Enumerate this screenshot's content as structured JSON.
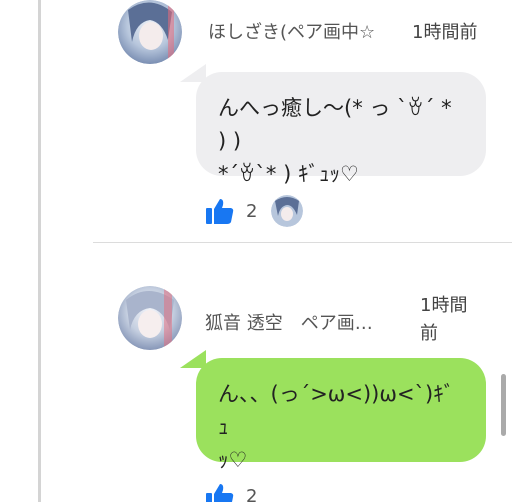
{
  "comments": [
    {
      "user_name": "ほしざき(ペア画中☆",
      "time": "1時間前",
      "message_line1": "んへっ癒し〜(* っ `ꈊ´ * ) )",
      "message_line2": "*´ꈊ`* ) ｷﾞｭｯ♡",
      "like_count": "2",
      "bubble_color": "#eeeef0"
    },
    {
      "user_name": "狐音 透空　ペア画…",
      "time_line1": "1時間",
      "time_line2": "前",
      "message_line1": "ん、、(っ´>ω<))ω<`)ｷﾞｭ",
      "message_line2": "ｯ♡",
      "like_count": "2",
      "bubble_color": "#9be15d"
    }
  ],
  "colors": {
    "like_blue": "#1877f2",
    "thread_line": "#d4d4d4"
  },
  "icons": [
    "thumbs-up-icon",
    "avatar"
  ]
}
